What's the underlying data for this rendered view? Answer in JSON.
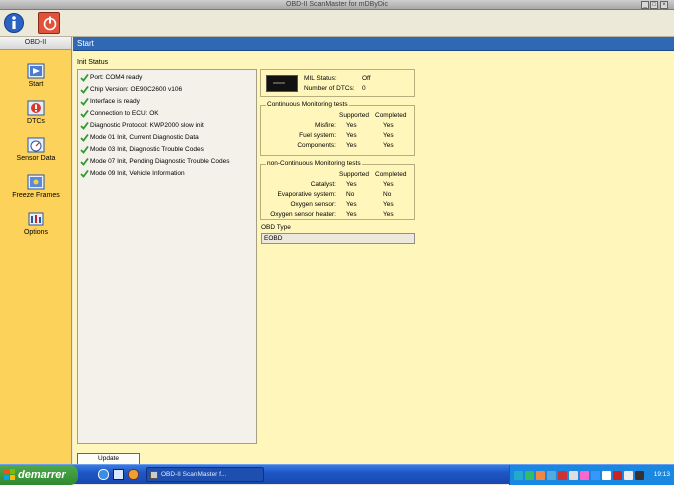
{
  "window": {
    "title": "OBD-II ScanMaster for mDByDic"
  },
  "toolbar": {
    "info_icon": "info-icon",
    "power_icon": "power-icon"
  },
  "sidebar": {
    "header": "OBD-II",
    "items": [
      {
        "label": "Start",
        "icon": "start-icon"
      },
      {
        "label": "DTCs",
        "icon": "dtc-icon"
      },
      {
        "label": "Sensor Data",
        "icon": "sensor-data-icon"
      },
      {
        "label": "Freeze Frames",
        "icon": "freeze-frames-icon"
      },
      {
        "label": "Options",
        "icon": "options-icon"
      }
    ]
  },
  "main": {
    "header": "Start",
    "init_status_title": "Init Status",
    "init_status": [
      "Port: COM4 ready",
      "Chip Version: OE90C2600 v106",
      "Interface is ready",
      "Connection to ECU: OK",
      "Diagnostic Protocol: KWP2000 slow init",
      "Mode 01 Init, Current Diagnostic Data",
      "Mode 03 Init, Diagnostic Trouble Codes",
      "Mode 07 Init, Pending Diagnostic Trouble Codes",
      "Mode 09 Init, Vehicle Information"
    ],
    "mil": {
      "status_label": "MIL Status:",
      "status_value": "Off",
      "dtc_label": "Number of DTCs:",
      "dtc_value": "0"
    },
    "continuous": {
      "title": "Continuous Monitoring tests",
      "col_supported": "Supported",
      "col_completed": "Completed",
      "rows": [
        {
          "label": "Misfire:",
          "supported": "Yes",
          "completed": "Yes"
        },
        {
          "label": "Fuel system:",
          "supported": "Yes",
          "completed": "Yes"
        },
        {
          "label": "Components:",
          "supported": "Yes",
          "completed": "Yes"
        }
      ]
    },
    "non_continuous": {
      "title": "non-Continuous Monitoring tests",
      "col_supported": "Supported",
      "col_completed": "Completed",
      "rows": [
        {
          "label": "Catalyst:",
          "supported": "Yes",
          "completed": "Yes"
        },
        {
          "label": "Evaporative system:",
          "supported": "No",
          "completed": "No"
        },
        {
          "label": "Oxygen sensor:",
          "supported": "Yes",
          "completed": "Yes"
        },
        {
          "label": "Oxygen sensor heater:",
          "supported": "Yes",
          "completed": "Yes"
        }
      ]
    },
    "obd_type": {
      "label": "OBD Type",
      "value": "EOBD"
    },
    "update_button": "Update"
  },
  "taskbar": {
    "start_label": "demarrer",
    "task_label": "OBD-II ScanMaster f...",
    "clock": "19:13"
  },
  "colors": {
    "sidebar_bg": "#fdd25a",
    "content_bg": "#fff6bb",
    "header_blue": "#3168b3",
    "check_green": "#2e9a2e",
    "taskbar_blue": "#1f56c6"
  }
}
